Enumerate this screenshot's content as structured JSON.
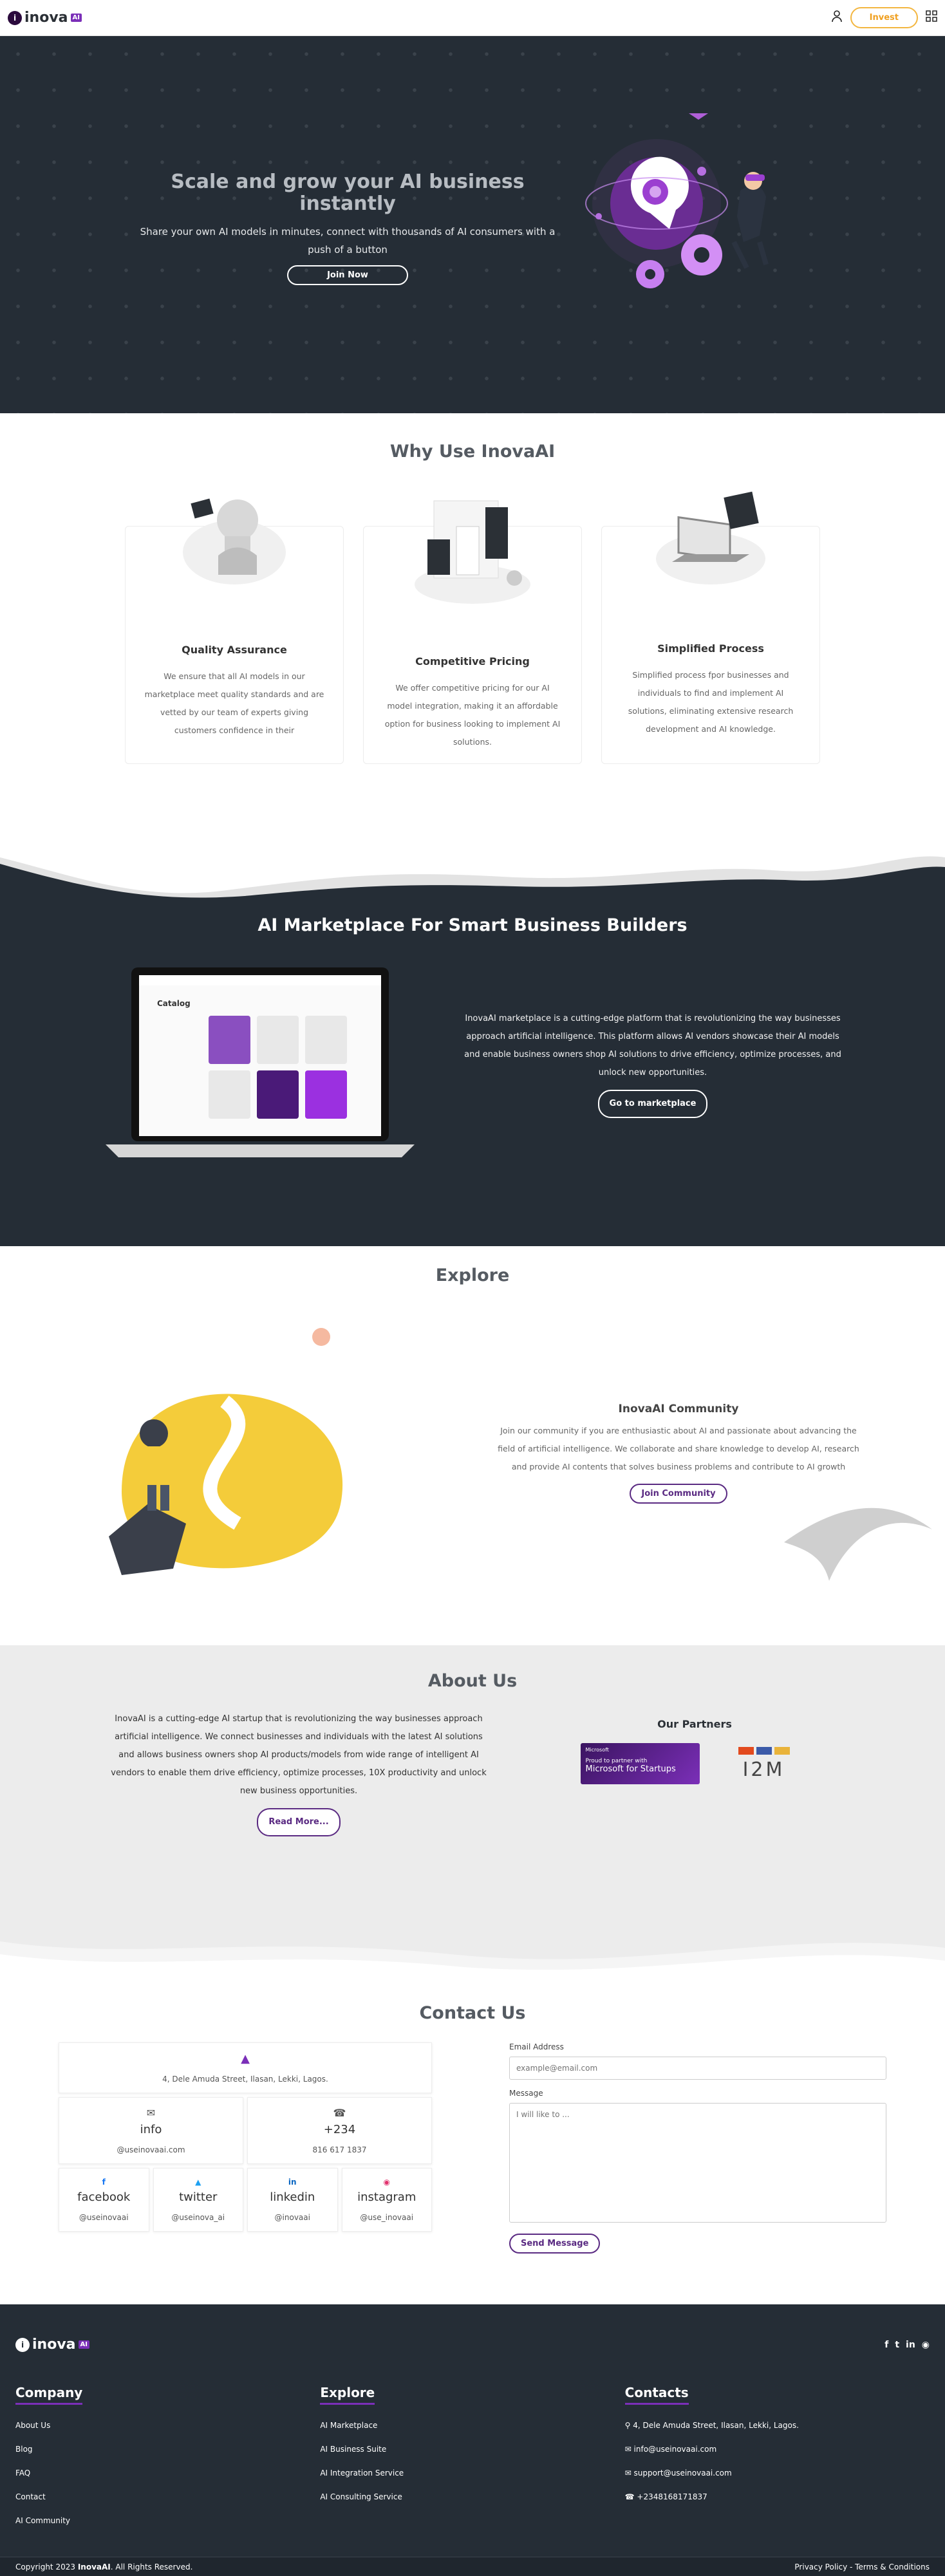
{
  "nav": {
    "brand": "inova",
    "brand_badge": "AI",
    "invest_label": "Invest"
  },
  "hero": {
    "title": "Scale and grow your AI business instantly",
    "subtitle": "Share your own AI models in minutes, connect with thousands of AI consumers with a push of a button",
    "cta": "Join Now"
  },
  "why": {
    "title": "Why Use InovaAI",
    "cards": [
      {
        "title": "Quality Assurance",
        "text": "We ensure that all AI models in our marketplace meet quality standards and are vetted by our team of experts giving customers confidence in their"
      },
      {
        "title": "Competitive Pricing",
        "text": "We offer competitive pricing for our AI model integration, making it an affordable option for business looking to implement AI solutions."
      },
      {
        "title": "Simplified Process",
        "text": "Simplified process fpor businesses and individuals to find and implement AI solutions, eliminating extensive research development and AI knowledge."
      }
    ]
  },
  "market": {
    "title": "AI Marketplace For Smart Business Builders",
    "text": "InovaAI marketplace is a cutting-edge platform that is revolutionizing the way businesses approach artificial intelligence. This platform allows AI vendors showcase their AI models and enable business owners shop AI solutions to drive efficiency, optimize processes, and unlock new opportunities.",
    "cta": "Go to marketplace",
    "screen_title": "Catalog"
  },
  "explore": {
    "title": "Explore",
    "community_title": "InovaAI Community",
    "community_text": "Join our community if you are enthusiastic about AI and passionate about advancing the field of artificial intelligence. We collaborate and share knowledge to develop AI, research and provide AI contents that solves business problems and contribute to AI growth",
    "cta": "Join Community"
  },
  "about": {
    "title": "About Us",
    "text": "InovaAI is a cutting-edge AI startup that is revolutionizing the way businesses approach artificial intelligence. We connect businesses and individuals with the latest AI solutions and allows business owners shop AI products/models from wide range of intelligent AI vendors to enable them drive efficiency, optimize processes, 10X productivity and unlock new business opportunities.",
    "cta": "Read More...",
    "partners_title": "Our Partners",
    "partner1_small": "Microsoft",
    "partner1_line1": "Proud to partner with",
    "partner1_line2": "Microsoft for Startups",
    "partner2": "I2M"
  },
  "contact": {
    "title": "Contact Us",
    "address": "4, Dele Amuda Street, Ilasan, Lekki, Lagos.",
    "email_label": "info",
    "email_value": "@useinovaai.com",
    "phone_label": "+234",
    "phone_value": "816 617 1837",
    "socials": [
      {
        "name": "facebook",
        "handle": "@useinovaai"
      },
      {
        "name": "twitter",
        "handle": "@useinova_ai"
      },
      {
        "name": "linkedin",
        "handle": "@inovaai"
      },
      {
        "name": "instagram",
        "handle": "@use_inovaai"
      }
    ],
    "form_email_label": "Email Address",
    "form_email_placeholder": "example@email.com",
    "form_message_label": "Message",
    "form_message_placeholder": "I will like to ...",
    "submit": "Send Message"
  },
  "footer": {
    "brand": "inova",
    "company_title": "Company",
    "company_links": [
      "About Us",
      "Blog",
      "FAQ",
      "Contact",
      "AI Community"
    ],
    "explore_title": "Explore",
    "explore_links": [
      "AI Marketplace",
      "AI Business Suite",
      "AI Integration Service",
      "AI Consulting Service"
    ],
    "contacts_title": "Contacts",
    "contacts": [
      "4, Dele Amuda Street, Ilasan, Lekki, Lagos.",
      "info@useinovaai.com",
      "support@useinovaai.com",
      "+2348168171837"
    ],
    "copyright_prefix": "Copyright 2023 ",
    "copyright_brand": "InovaAI",
    "copyright_suffix": ". All Rights Reserved.",
    "privacy": "Privacy Policy",
    "terms": "Terms & Conditions"
  },
  "colors": {
    "dark": "#252d36",
    "purple": "#7b2fb8",
    "orange": "#f3b640"
  }
}
